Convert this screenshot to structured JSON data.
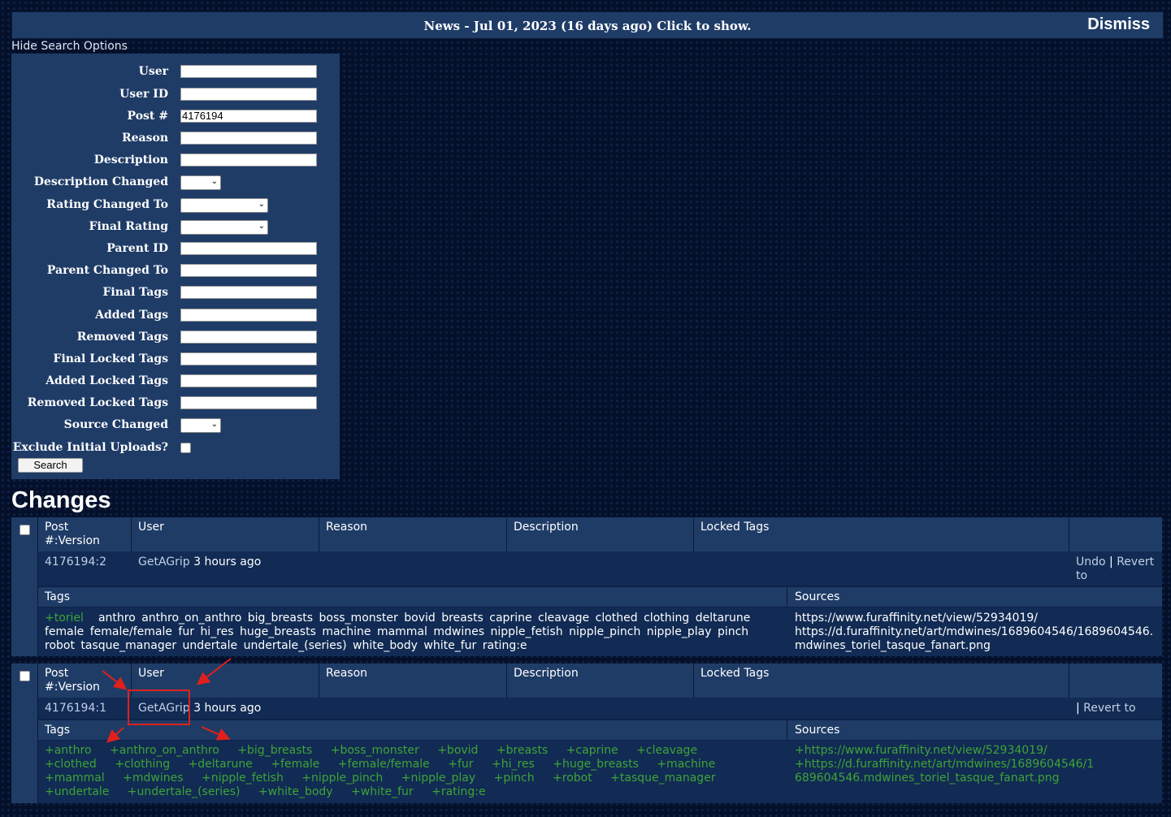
{
  "news": {
    "message": "News - Jul 01, 2023 (16 days ago) Click to show.",
    "dismiss": "Dismiss"
  },
  "search": {
    "toggle": "Hide Search Options",
    "fields": [
      {
        "label": "User",
        "type": "text",
        "value": ""
      },
      {
        "label": "User ID",
        "type": "text",
        "value": ""
      },
      {
        "label": "Post #",
        "type": "text",
        "value": "4176194"
      },
      {
        "label": "Reason",
        "type": "text",
        "value": ""
      },
      {
        "label": "Description",
        "type": "text",
        "value": ""
      },
      {
        "label": "Description Changed",
        "type": "select-small",
        "value": ""
      },
      {
        "label": "Rating Changed To",
        "type": "select",
        "value": ""
      },
      {
        "label": "Final Rating",
        "type": "select",
        "value": ""
      },
      {
        "label": "Parent ID",
        "type": "text",
        "value": ""
      },
      {
        "label": "Parent Changed To",
        "type": "text",
        "value": ""
      },
      {
        "label": "Final Tags",
        "type": "text",
        "value": ""
      },
      {
        "label": "Added Tags",
        "type": "text",
        "value": ""
      },
      {
        "label": "Removed Tags",
        "type": "text",
        "value": ""
      },
      {
        "label": "Final Locked Tags",
        "type": "text",
        "value": ""
      },
      {
        "label": "Added Locked Tags",
        "type": "text",
        "value": ""
      },
      {
        "label": "Removed Locked Tags",
        "type": "text",
        "value": ""
      },
      {
        "label": "Source Changed",
        "type": "select-small",
        "value": ""
      },
      {
        "label": "Exclude Initial Uploads?",
        "type": "checkbox",
        "value": ""
      }
    ],
    "button": "Search"
  },
  "changes_title": "Changes",
  "columns": {
    "post_line1": "Post",
    "post_line2": "#:Version",
    "user": "User",
    "reason": "Reason",
    "description": "Description",
    "locked_tags": "Locked Tags",
    "tags": "Tags",
    "sources": "Sources"
  },
  "changes": [
    {
      "post_version": "4176194:2",
      "user": "GetAGrip",
      "time": "3 hours ago",
      "undo": "Undo",
      "separator": "|",
      "revert": "Revert to",
      "added_tags": [
        "+toriel"
      ],
      "tags": [
        "anthro",
        "anthro_on_anthro",
        "big_breasts",
        "boss_monster",
        "bovid",
        "breasts",
        "caprine",
        "cleavage",
        "clothed",
        "clothing",
        "deltarune",
        "female",
        "female/female",
        "fur",
        "hi_res",
        "huge_breasts",
        "machine",
        "mammal",
        "mdwines",
        "nipple_fetish",
        "nipple_pinch",
        "nipple_play",
        "pinch",
        "robot",
        "tasque_manager",
        "undertale",
        "undertale_(series)",
        "white_body",
        "white_fur",
        "rating:e"
      ],
      "sources": [
        "https://www.furaffinity.net/view/52934019/",
        "https://d.furaffinity.net/art/mdwines/1689604546/1689604546.mdwines_toriel_tasque_fanart.png"
      ]
    },
    {
      "post_version": "4176194:1",
      "user": "GetAGrip",
      "time": "3 hours ago",
      "separator": "|",
      "revert": "Revert to",
      "added_tags": [
        "+anthro",
        "+anthro_on_anthro",
        "+big_breasts",
        "+boss_monster",
        "+bovid",
        "+breasts",
        "+caprine",
        "+cleavage",
        "+clothed",
        "+clothing",
        "+deltarune",
        "+female",
        "+female/female",
        "+fur",
        "+hi_res",
        "+huge_breasts",
        "+machine",
        "+mammal",
        "+mdwines",
        "+nipple_fetish",
        "+nipple_pinch",
        "+nipple_play",
        "+pinch",
        "+robot",
        "+tasque_manager",
        "+undertale",
        "+undertale_(series)",
        "+white_body",
        "+white_fur",
        "+rating:e"
      ],
      "sources": [
        "+https://www.furaffinity.net/view/52934019/",
        "+https://d.furaffinity.net/art/mdwines/1689604546/1689604546.mdwines_toriel_tasque_fanart.png"
      ]
    }
  ],
  "colors": {
    "panel": "#1f3c67",
    "row": "#112b54",
    "added_tag": "#3fa336",
    "annotation": "#e0201c"
  }
}
